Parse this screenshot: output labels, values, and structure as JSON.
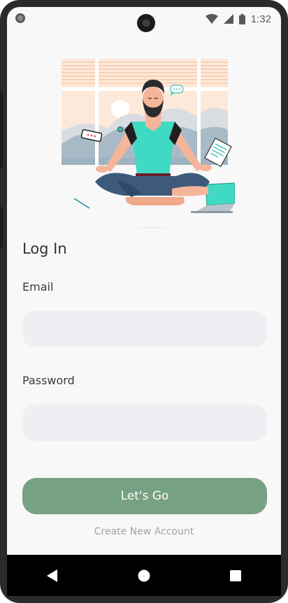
{
  "status_bar": {
    "time": "1:32",
    "icons": [
      "wifi-icon",
      "signal-icon",
      "battery-icon"
    ]
  },
  "login": {
    "title": "Log In",
    "email_label": "Email",
    "email_value": "",
    "password_label": "Password",
    "password_value": "",
    "submit_label": "Let's Go",
    "create_account_label": "Create New Account"
  },
  "navigation": {
    "buttons": [
      "back-icon",
      "home-icon",
      "recents-icon"
    ]
  },
  "colors": {
    "accent": "#77a183",
    "input_background": "#efeff3",
    "screen_background": "#f8f8f8",
    "illustration_teal": "#40d9c4"
  }
}
